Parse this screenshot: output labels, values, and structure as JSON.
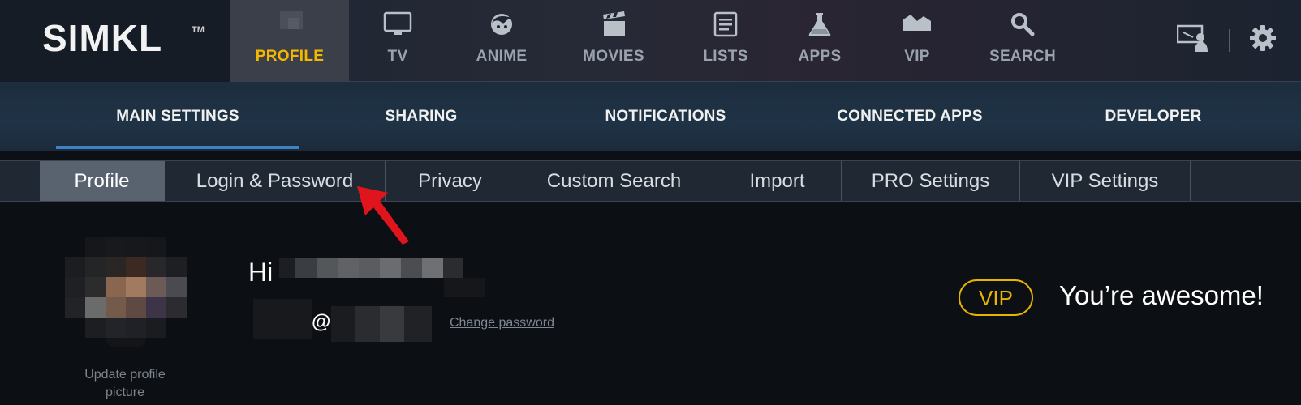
{
  "brand": {
    "name": "SIMKL",
    "tm": "TM"
  },
  "nav": [
    {
      "label": "PROFILE",
      "icon": "profile-icon",
      "active": true
    },
    {
      "label": "TV",
      "icon": "tv-icon"
    },
    {
      "label": "ANIME",
      "icon": "anime-icon"
    },
    {
      "label": "MOVIES",
      "icon": "movies-icon"
    },
    {
      "label": "LISTS",
      "icon": "lists-icon"
    },
    {
      "label": "APPS",
      "icon": "apps-icon"
    },
    {
      "label": "VIP",
      "icon": "vip-icon"
    },
    {
      "label": "SEARCH",
      "icon": "search-icon"
    }
  ],
  "header_right": {
    "icons": [
      "presentation-icon",
      "gear-icon"
    ]
  },
  "settings_tabs": [
    {
      "label": "MAIN SETTINGS",
      "active": true
    },
    {
      "label": "SHARING"
    },
    {
      "label": "NOTIFICATIONS"
    },
    {
      "label": "CONNECTED APPS"
    },
    {
      "label": "DEVELOPER"
    }
  ],
  "sub_tabs": [
    {
      "label": "Profile",
      "active": true
    },
    {
      "label": "Login & Password"
    },
    {
      "label": "Privacy"
    },
    {
      "label": "Custom Search"
    },
    {
      "label": "Import"
    },
    {
      "label": "PRO Settings"
    },
    {
      "label": "VIP Settings"
    }
  ],
  "profile": {
    "avatar_caption": "Update profile picture",
    "greeting": "Hi",
    "email_at": "@",
    "change_password": "Change password",
    "vip_badge": "VIP",
    "vip_message": "You’re awesome!"
  },
  "colors": {
    "accent": "#f5b800",
    "tab_underline": "#3b83c4",
    "annotation_arrow": "#e0141c"
  }
}
